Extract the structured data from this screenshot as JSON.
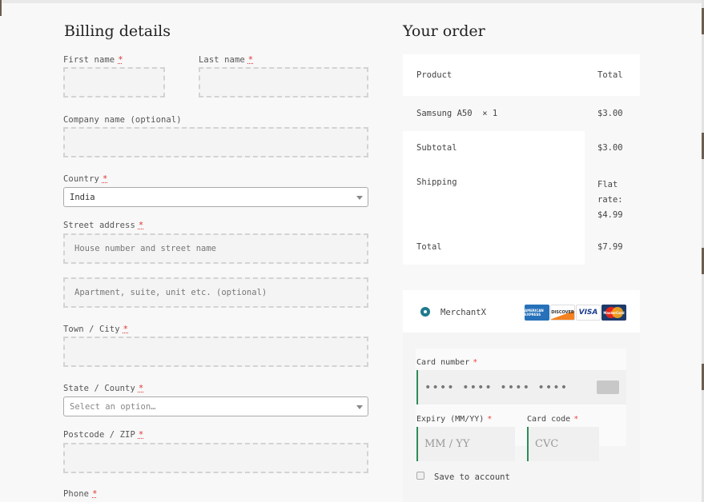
{
  "billing": {
    "title": "Billing details",
    "first_name": {
      "label": "First name",
      "required": "*",
      "value": ""
    },
    "last_name": {
      "label": "Last name",
      "required": "*",
      "value": ""
    },
    "company": {
      "label": "Company name (optional)",
      "value": ""
    },
    "country": {
      "label": "Country",
      "required": "*",
      "selected": "India"
    },
    "street": {
      "label": "Street address",
      "required": "*",
      "placeholder_1": "House number and street name",
      "placeholder_2": "Apartment, suite, unit etc. (optional)"
    },
    "town": {
      "label": "Town / City",
      "required": "*",
      "value": ""
    },
    "state": {
      "label": "State / County",
      "required": "*",
      "placeholder": "Select an option…"
    },
    "postcode": {
      "label": "Postcode / ZIP",
      "required": "*",
      "value": ""
    },
    "phone": {
      "label": "Phone",
      "required": "*"
    }
  },
  "order": {
    "title": "Your order",
    "headers": {
      "product": "Product",
      "total": "Total"
    },
    "items": [
      {
        "name": "Samsung A50",
        "qty": "× 1",
        "total": "$3.00"
      }
    ],
    "subtotal": {
      "label": "Subtotal",
      "value": "$3.00"
    },
    "shipping": {
      "label": "Shipping",
      "value_lines": [
        "Flat",
        "rate:",
        "$4.99"
      ]
    },
    "total": {
      "label": "Total",
      "value": "$7.99"
    }
  },
  "payment": {
    "method": "MerchantX",
    "cards": [
      "AMERICAN EXPRESS",
      "DISCOVER",
      "VISA",
      "MasterCard"
    ],
    "card_number": {
      "label": "Card number",
      "required": "*",
      "placeholder": "•••• •••• •••• ••••"
    },
    "expiry": {
      "label": "Expiry (MM/YY)",
      "required": "*",
      "placeholder": "MM / YY"
    },
    "cvc": {
      "label": "Card code",
      "required": "*",
      "placeholder": "CVC"
    },
    "save_label": "Save to account"
  },
  "colors": {
    "accent": "#1f7a8c",
    "valid_border": "#2e8b57",
    "required": "#dd3333"
  }
}
